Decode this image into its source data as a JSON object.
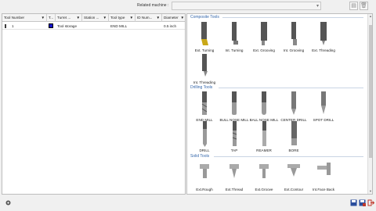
{
  "top": {
    "machine_label": "Related machine :",
    "machine_value": ""
  },
  "grid": {
    "columns": [
      "Tool Number",
      "T...",
      "Turret ...",
      "Station ...",
      "Tool type",
      "ID Num...",
      "Diameter"
    ],
    "rows": [
      {
        "number": "1",
        "turret": "Tool storage",
        "station": "",
        "type": "END MILL",
        "id": "",
        "diameter": "0.5 inch",
        "color": "#1515c8"
      }
    ]
  },
  "panel": {
    "sections": [
      {
        "title": "Composite Tools",
        "tools": [
          "Ext. Turning",
          "Int. Turning",
          "Ext. Grooving",
          "Int. Grooving",
          "Ext. Threading",
          "Int. Threading"
        ]
      },
      {
        "title": "Drilling Tools",
        "tools": [
          "END MILL",
          "BULL NOSE MILL",
          "BALL NOSE MILL",
          "CENTER DRILL",
          "SPOT DRILL",
          "DRILL",
          "TAP",
          "REAMER",
          "BORE"
        ]
      },
      {
        "title": "Solid Tools",
        "tools": [
          "Ext.Rough",
          "Ext.Thread",
          "Ext.Groove",
          "Ext.Contour",
          "Int.Face Back"
        ]
      }
    ]
  },
  "colors": {
    "accent": "#3366aa",
    "selected_tool": "#1515c8"
  }
}
